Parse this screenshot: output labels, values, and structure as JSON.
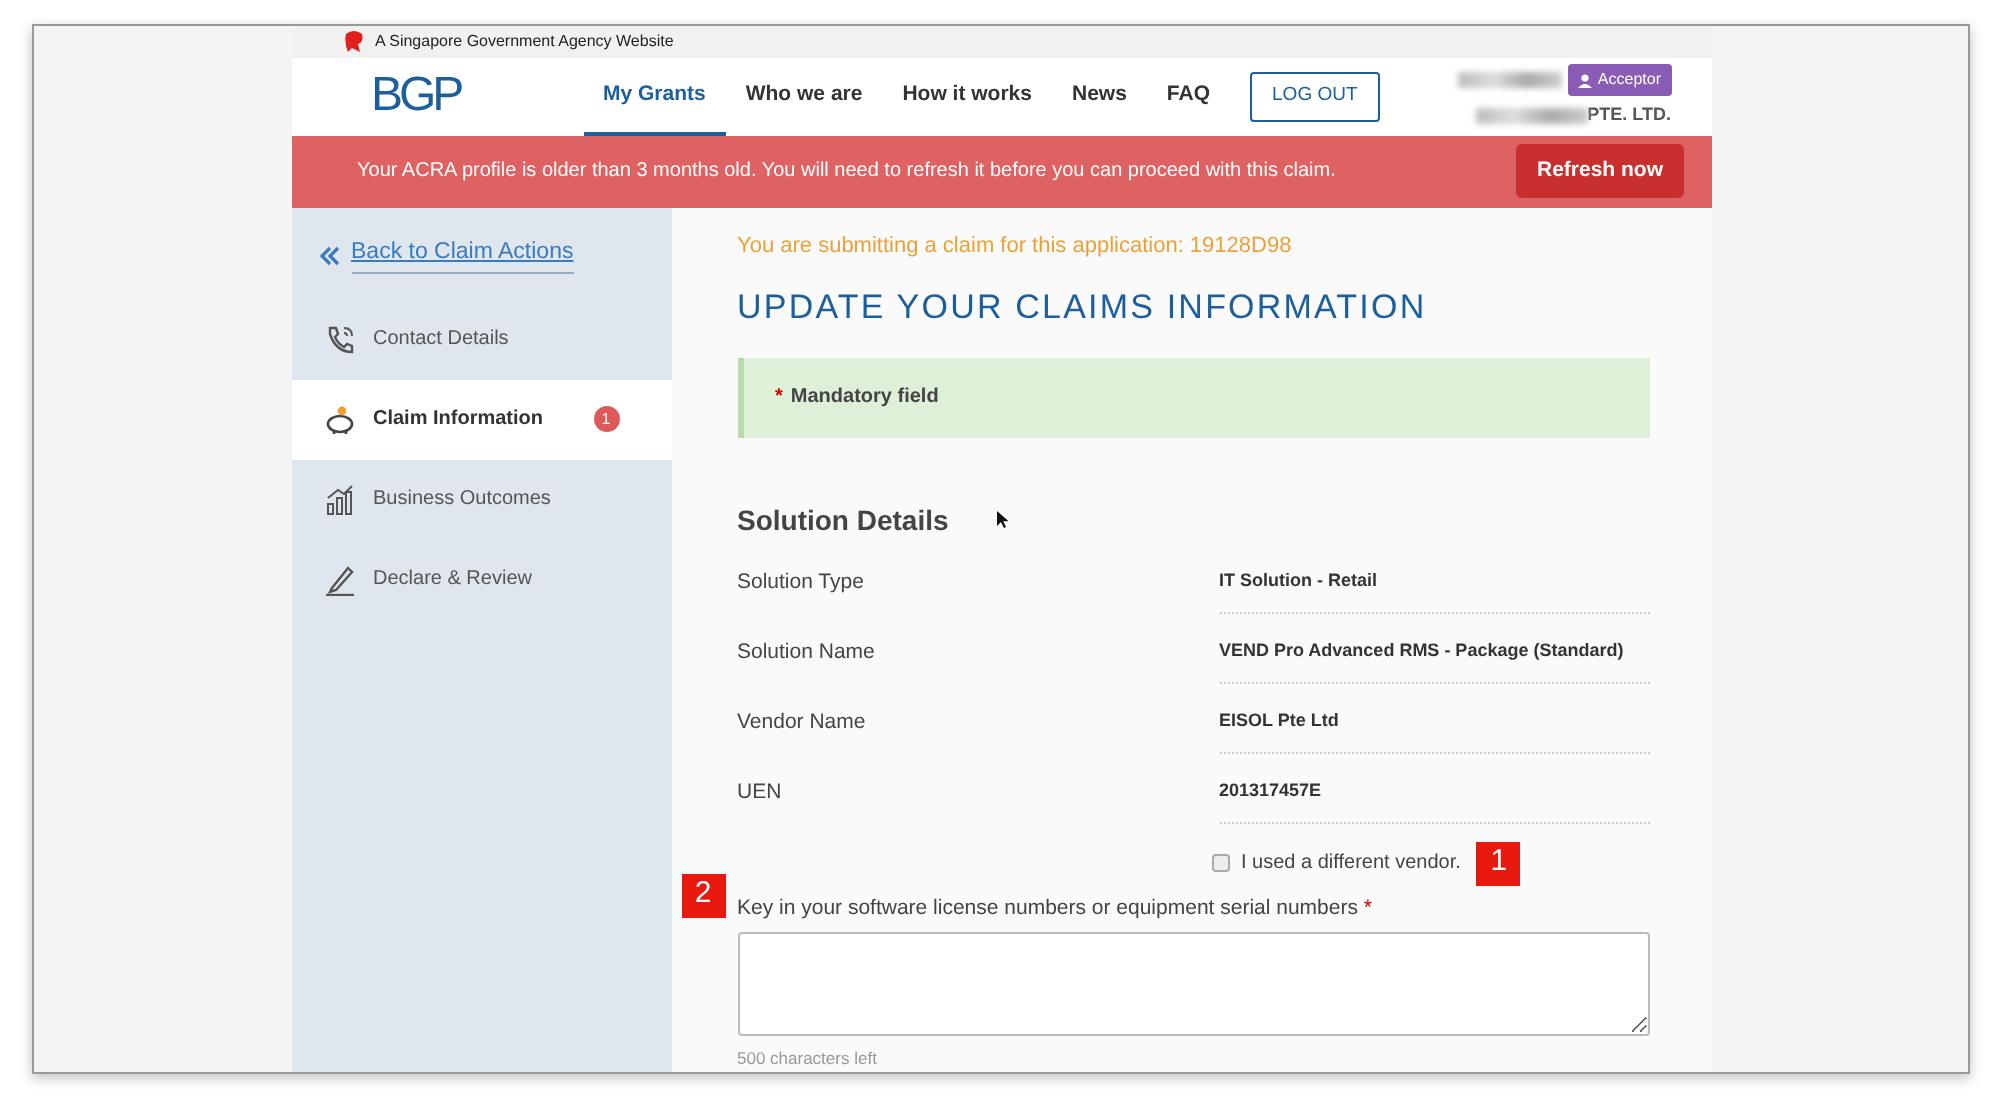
{
  "top_strip": {
    "text": "A Singapore Government Agency Website"
  },
  "header": {
    "logo": "BGP",
    "nav": [
      {
        "label": "My Grants",
        "selected": true
      },
      {
        "label": "Who we are",
        "selected": false
      },
      {
        "label": "How it works",
        "selected": false
      },
      {
        "label": "News",
        "selected": false
      },
      {
        "label": "FAQ",
        "selected": false
      }
    ],
    "logout": "LOG OUT",
    "user": {
      "role": "Acceptor",
      "company_suffix": "PTE. LTD."
    }
  },
  "alert": {
    "message": "Your ACRA profile is older than 3 months old. You will need to refresh it before you can proceed with this claim.",
    "button": "Refresh now"
  },
  "sidebar": {
    "back_link": "Back to Claim Actions",
    "items": [
      {
        "label": "Contact Details",
        "selected": false
      },
      {
        "label": "Claim Information",
        "selected": true,
        "badge": "1"
      },
      {
        "label": "Business Outcomes",
        "selected": false
      },
      {
        "label": "Declare & Review",
        "selected": false
      }
    ]
  },
  "main": {
    "notice": "You are submitting a claim for this application: 19128D98",
    "title": "UPDATE YOUR CLAIMS INFORMATION",
    "mandatory_note": {
      "marker": "*",
      "text": "Mandatory field"
    },
    "section_title": "Solution Details",
    "details": [
      {
        "label": "Solution Type",
        "value": "IT Solution - Retail"
      },
      {
        "label": "Solution Name",
        "value": "VEND Pro Advanced RMS - Package (Standard)"
      },
      {
        "label": "Vendor Name",
        "value": "EISOL Pte Ltd"
      },
      {
        "label": "UEN",
        "value": "201317457E"
      }
    ],
    "different_vendor": {
      "label": "I used a different vendor.",
      "checked": false,
      "callout": "1"
    },
    "serial_field": {
      "label": "Key in your software license numbers or equipment serial numbers",
      "required_marker": "*",
      "callout": "2",
      "hint": "500 characters left"
    }
  }
}
